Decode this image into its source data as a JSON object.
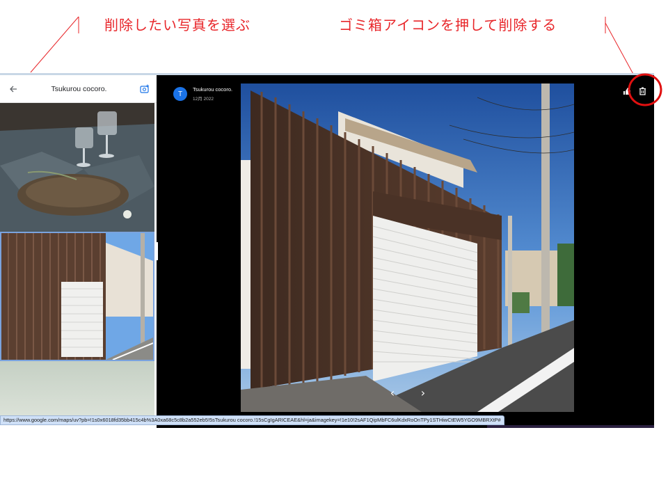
{
  "annotations": {
    "select_label": "削除したい写真を選ぶ",
    "delete_label": "ゴミ箱アイコンを押して削除する",
    "color": "#e8262a"
  },
  "sidebar": {
    "back_icon": "arrow-left-icon",
    "title": "Tsukurou cocoro.",
    "add_photo_icon": "add-photo-icon",
    "thumbnails": [
      {
        "name": "glasses-on-tray-photo",
        "selected": false
      },
      {
        "name": "wooden-garage-photo",
        "selected": true
      },
      {
        "name": "green-wall-photo",
        "selected": false
      }
    ]
  },
  "viewer": {
    "author_initial": "T",
    "author_name": "Tsukurou cocoro.",
    "date": "12月 2022",
    "share_icon": "share-icon",
    "delete_icon": "trash-icon",
    "prev_icon": "chevron-left-icon",
    "next_icon": "chevron-right-icon",
    "prev_glyph": "‹",
    "next_glyph": "›"
  },
  "status": {
    "url": "https://www.google.com/maps/uv?pb=!1s0x6018fd35bb415c4b%3A0xa68c5c8b2a552eb5!5sTsukurou cocoro.!15sCgIgARICEAE&hl=ja&imagekey=!1e10!2sAF1QipMbFC6ulKdxRoOnTPy1STHiwCtEW5YGO9MBRXtP#"
  },
  "colors": {
    "accent": "#1a73e8",
    "selected_border": "#7aa3de",
    "url_bar": "#cfe0f7",
    "viewer_bg": "#000000"
  }
}
